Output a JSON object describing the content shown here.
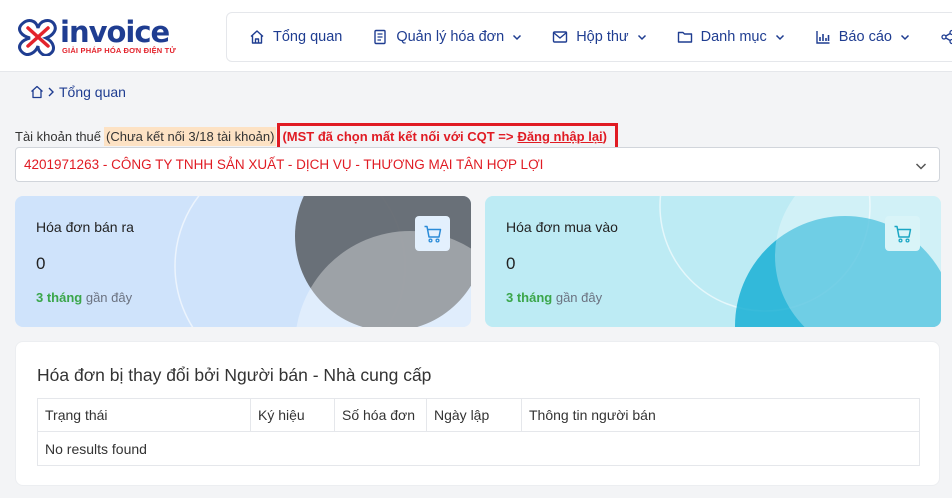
{
  "brand": {
    "name": "invoice",
    "tagline": "GIẢI PHÁP HÓA ĐƠN ĐIỆN TỬ",
    "primary_color": "#1f3d91",
    "accent_color": "#e3232c"
  },
  "nav": {
    "items": [
      {
        "label": "Tổng quan",
        "icon": "home-icon",
        "dropdown": false
      },
      {
        "label": "Quản lý hóa đơn",
        "icon": "document-icon",
        "dropdown": true
      },
      {
        "label": "Hộp thư",
        "icon": "mail-icon",
        "dropdown": true
      },
      {
        "label": "Danh mục",
        "icon": "folder-icon",
        "dropdown": true
      },
      {
        "label": "Báo cáo",
        "icon": "chart-icon",
        "dropdown": true
      },
      {
        "label": "",
        "icon": "share-icon",
        "dropdown": false
      }
    ]
  },
  "breadcrumb": {
    "current": "Tổng quan"
  },
  "tax_account": {
    "label": "Tài khoản thuế",
    "connection_status": "(Chưa kết nối 3/18 tài khoản)",
    "warning_text": "(MST đã chọn mất kết nối với CQT =>",
    "relogin_link": "Đăng nhập lại",
    "warning_close": ")",
    "selected_company": "4201971263 - CÔNG TY TNHH SẢN XUẤT - DỊCH VỤ - THƯƠNG MẠI TÂN HỢP LỢI"
  },
  "cards": {
    "sell": {
      "title": "Hóa đơn bán ra",
      "value": "0",
      "period_months": "3 tháng",
      "period_rest": " gần đây",
      "color": "#cfe3fb"
    },
    "buy": {
      "title": "Hóa đơn mua vào",
      "value": "0",
      "period_months": "3 tháng",
      "period_rest": " gần đây",
      "color": "#bdebf4"
    }
  },
  "changed_invoices": {
    "title": "Hóa đơn bị thay đổi bởi Người bán - Nhà cung cấp",
    "columns": [
      "Trạng thái",
      "Ký hiệu",
      "Số hóa đơn",
      "Ngày lập",
      "Thông tin người bán"
    ],
    "empty_text": "No results found"
  }
}
